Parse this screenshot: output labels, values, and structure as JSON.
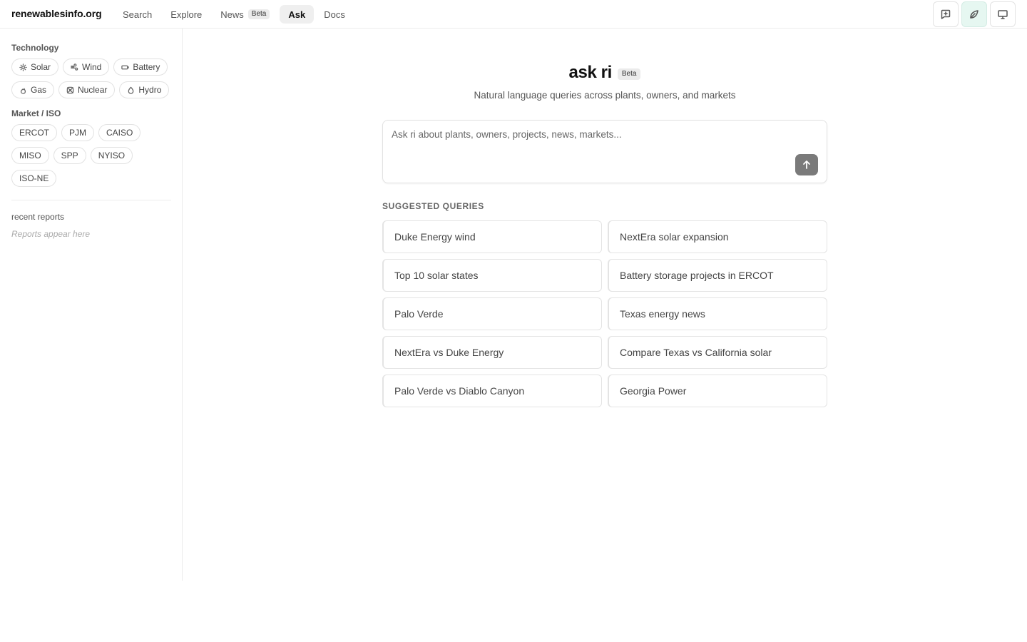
{
  "header": {
    "brand": "renewablesinfo.org",
    "nav": [
      {
        "label": "Search"
      },
      {
        "label": "Explore"
      },
      {
        "label": "News",
        "badge": "Beta"
      },
      {
        "label": "Ask"
      },
      {
        "label": "Docs"
      }
    ],
    "active_nav": "Ask",
    "icons": [
      "new-chat-icon",
      "leaf-icon",
      "monitor-icon"
    ],
    "accent_active_bg": "#e6f7f1"
  },
  "sidebar": {
    "technology_heading": "Technology",
    "technology": [
      {
        "label": "Solar",
        "icon": "sun-icon"
      },
      {
        "label": "Wind",
        "icon": "wind-icon"
      },
      {
        "label": "Battery",
        "icon": "battery-icon"
      },
      {
        "label": "Gas",
        "icon": "flame-icon"
      },
      {
        "label": "Nuclear",
        "icon": "atom-icon"
      },
      {
        "label": "Hydro",
        "icon": "droplet-icon"
      }
    ],
    "market_heading": "Market / ISO",
    "markets": [
      "ERCOT",
      "PJM",
      "CAISO",
      "MISO",
      "SPP",
      "NYISO",
      "ISO-NE"
    ],
    "recent_title": "recent reports",
    "recent_empty": "Reports appear here"
  },
  "main": {
    "title": "ask ri",
    "title_badge": "Beta",
    "subtitle": "Natural language queries across plants, owners, and markets",
    "ask_placeholder": "Ask ri about plants, owners, projects, news, markets...",
    "suggested_label": "SUGGESTED QUERIES",
    "suggestions": [
      "Duke Energy wind",
      "NextEra solar expansion",
      "Top 10 solar states",
      "Battery storage projects in ERCOT",
      "Palo Verde",
      "Texas energy news",
      "NextEra vs Duke Energy",
      "Compare Texas vs California solar",
      "Palo Verde vs Diablo Canyon",
      "Georgia Power"
    ]
  }
}
